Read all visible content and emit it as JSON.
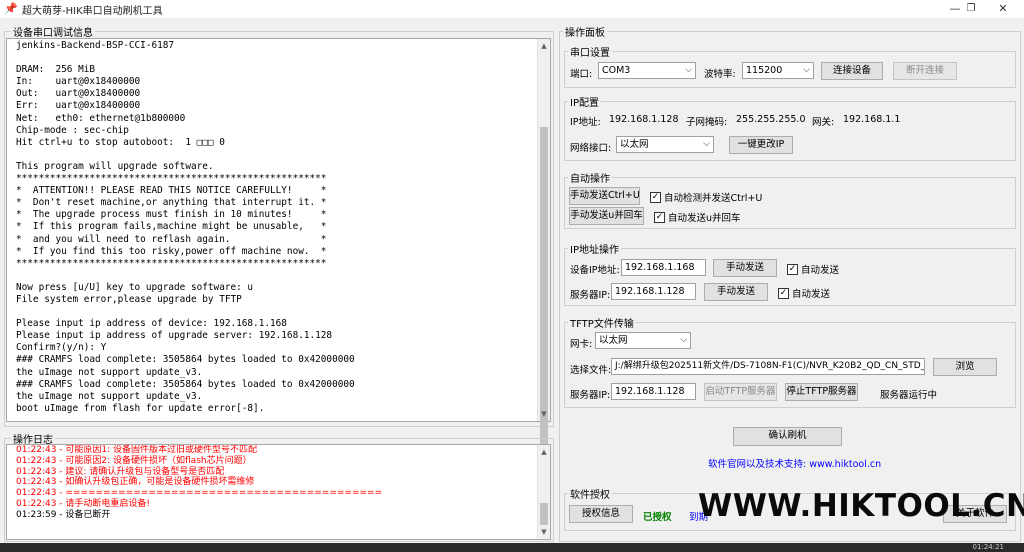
{
  "window": {
    "title": "超大萌芽-HIK串口自动刷机工具",
    "minimize": "—",
    "restore": "❐",
    "close": "✕"
  },
  "serial_debug": {
    "title": "设备串口调试信息",
    "text": "jenkins-Backend-BSP-CCI-6187\n\nDRAM:  256 MiB\nIn:    uart@0x18400000\nOut:   uart@0x18400000\nErr:   uart@0x18400000\nNet:   eth0: ethernet@1b800000\nChip-mode : sec-chip\nHit ctrl+u to stop autoboot:  1 □□□ 0\n\nThis program will upgrade software.\n*******************************************************\n*  ATTENTION!! PLEASE READ THIS NOTICE CAREFULLY!     *\n*  Don't reset machine,or anything that interrupt it. *\n*  The upgrade process must finish in 10 minutes!     *\n*  If this program fails,machine might be unusable,   *\n*  and you will need to reflash again.                *\n*  If you find this too risky,power off machine now.  *\n*******************************************************\n\nNow press [u/U] key to upgrade software: u\nFile system error,please upgrade by TFTP\n\nPlease input ip address of device: 192.168.1.168\nPlease input ip address of upgrade server: 192.168.1.128\nConfirm?(y/n): Y\n### CRAMFS load complete: 3505864 bytes loaded to 0x42000000\nthe uImage not support update_v3.\n### CRAMFS load complete: 3505864 bytes loaded to 0x42000000\nthe uImage not support update_v3.\nboot uImage from flash for update error[-8]."
  },
  "op_log": {
    "title": "操作日志",
    "lines": [
      {
        "text": "01:22:43 - 可能原因1: 设备固件版本过旧或硬件型号不匹配",
        "color": "#ff0000"
      },
      {
        "text": "01:22:43 - 可能原因2: 设备硬件损坏（如flash芯片问题）",
        "color": "#ff0000"
      },
      {
        "text": "01:22:43 - 建议: 请确认升级包与设备型号是否匹配",
        "color": "#ff0000"
      },
      {
        "text": "01:22:43 - 如确认升级包正确，可能是设备硬件损坏需维修",
        "color": "#ff0000"
      },
      {
        "text": "01:22:43 - ==========================================",
        "color": "#ff0000"
      },
      {
        "text": "01:22:43 - 请手动断电重启设备!",
        "color": "#ff0000"
      },
      {
        "text": "01:23:59 - 设备已断开",
        "color": "#000000"
      }
    ]
  },
  "panel": {
    "title": "操作面板",
    "serial": {
      "title": "串口设置",
      "port_label": "端口:",
      "port_value": "COM3",
      "baud_label": "波特率:",
      "baud_value": "115200",
      "connect": "连接设备",
      "disconnect": "断开连接"
    },
    "ip_config": {
      "title": "IP配置",
      "ip_label": "IP地址:",
      "ip_value": "192.168.1.128",
      "mask_label": "子网掩码:",
      "mask_value": "255.255.255.0",
      "gw_label": "网关:",
      "gw_value": "192.168.1.1",
      "iface_label": "网络接口:",
      "iface_value": "以太网",
      "change_ip": "一键更改IP"
    },
    "auto_ops": {
      "title": "自动操作",
      "send_ctrlu": "手动发送Ctrl+U",
      "auto_ctrlu": "自动检测并发送Ctrl+U",
      "send_u": "手动发送u并回车",
      "auto_u": "自动发送u并回车"
    },
    "ip_ops": {
      "title": "IP地址操作",
      "dev_ip_label": "设备IP地址:",
      "dev_ip_value": "192.168.1.168",
      "send1": "手动发送",
      "auto1": "自动发送",
      "srv_ip_label": "服务器IP:",
      "srv_ip_value": "192.168.1.128",
      "send2": "手动发送",
      "auto2": "自动发送"
    },
    "tftp": {
      "title": "TFTP文件传输",
      "nic_label": "网卡:",
      "nic_value": "以太网",
      "file_label": "选择文件:",
      "file_value": "J:/解绑升级包202511新文件/DS-7108N-F1(C)/NVR_K20B2_QD_CN_STD_V",
      "browse": "浏览",
      "srv_label": "服务器IP:",
      "srv_value": "192.168.1.128",
      "start": "启动TFTP服务器",
      "stop": "停止TFTP服务器",
      "status": "服务器运行中"
    },
    "confirm_flash": "确认刷机",
    "support": "软件官网以及技术支持: www.hiktool.cn",
    "license": {
      "title": "软件授权",
      "info_btn": "授权信息",
      "status": "已授权",
      "expiry_prefix": "到期",
      "about": "关于软件"
    }
  },
  "watermark": "WWW.HIKTOOL.CN",
  "clock": "01:24:21",
  "icons": {
    "app": "pin-icon",
    "dropdown": "chevron-down-icon",
    "scroll_up": "arrow-up-icon",
    "scroll_down": "arrow-down-icon",
    "check": "check-icon"
  }
}
